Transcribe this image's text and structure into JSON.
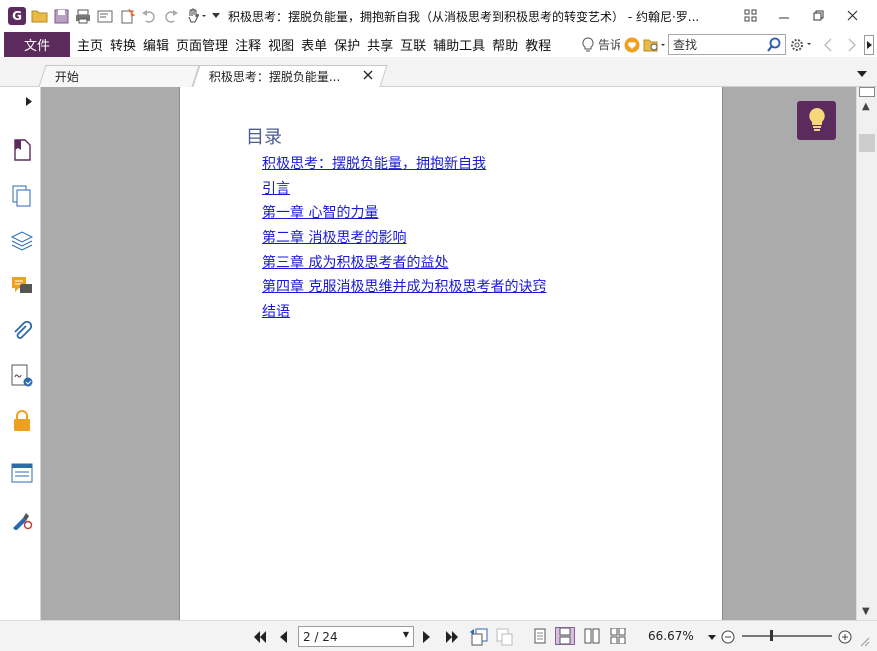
{
  "window": {
    "title": "积极思考：摆脱负能量，拥抱新自我（从消极思考到积极思考的转变艺术） - 约翰尼·罗..."
  },
  "menubar": {
    "file_label": "文件",
    "items": [
      "主页",
      "转换",
      "编辑",
      "页面管理",
      "注释",
      "视图",
      "表单",
      "保护",
      "共享",
      "互联",
      "辅助工具",
      "帮助",
      "教程"
    ],
    "tell_me_label": "告诉",
    "search_placeholder": "查找"
  },
  "tabs": [
    {
      "label": "开始"
    },
    {
      "label": "积极思考：摆脱负能量..."
    }
  ],
  "document": {
    "toc_title": "目录",
    "toc_items": [
      "积极思考：摆脱负能量，拥抱新自我",
      "引言",
      "第一章 心智的力量",
      "第二章 消极思考的影响",
      "第三章 成为积极思考者的益处",
      "第四章 克服消极思维并成为积极思考者的诀窍",
      "结语"
    ]
  },
  "statusbar": {
    "page_display": "2 / 24",
    "zoom": "66.67%"
  },
  "colors": {
    "brand": "#5b2b5e",
    "link": "#1a1ad6",
    "toc_heading": "#4a5d90",
    "canvas": "#ababab"
  },
  "icons": {
    "sidebar": [
      "bookmark-icon",
      "pages-icon",
      "layers-icon",
      "comments-icon",
      "attachments-icon",
      "signature-icon",
      "security-icon",
      "fields-icon",
      "certify-icon"
    ]
  }
}
